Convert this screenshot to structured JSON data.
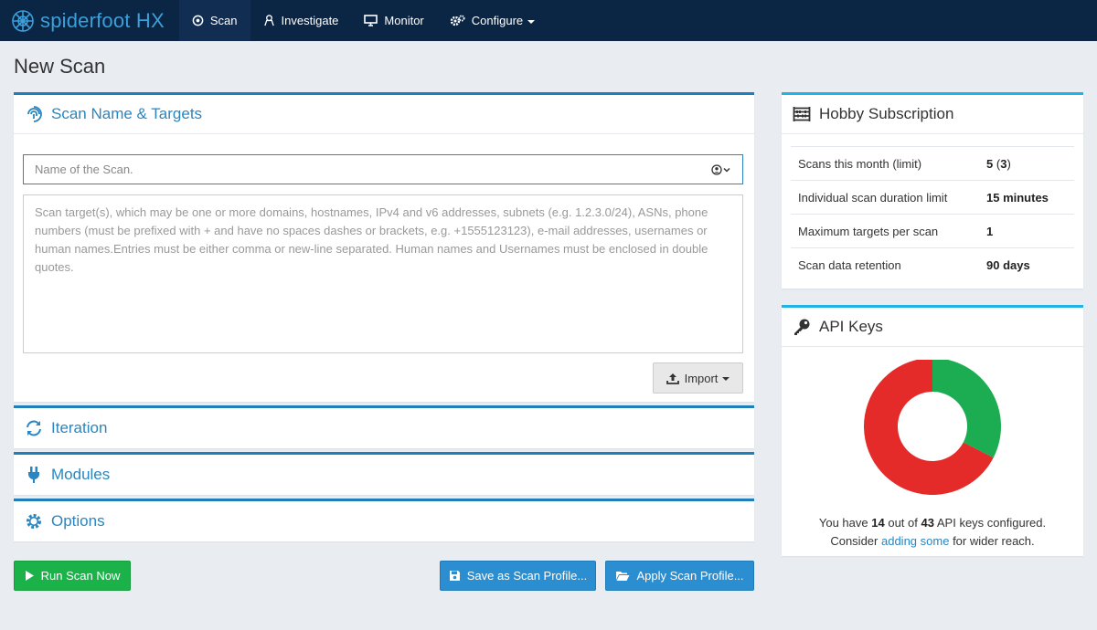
{
  "navbar": {
    "brand": "spiderfoot HX",
    "items": [
      {
        "label": "Scan",
        "icon": "target-icon",
        "active": true
      },
      {
        "label": "Investigate",
        "icon": "investigate-icon",
        "active": false
      },
      {
        "label": "Monitor",
        "icon": "monitor-icon",
        "active": false
      },
      {
        "label": "Configure",
        "icon": "gears-icon",
        "active": false,
        "dropdown": true
      }
    ]
  },
  "page_title": "New Scan",
  "targets_panel": {
    "title": "Scan Name & Targets",
    "name_placeholder": "Name of the Scan.",
    "name_value": "",
    "targets_placeholder": "Scan target(s), which may be one or more domains, hostnames, IPv4 and v6 addresses, subnets (e.g. 1.2.3.0/24), ASNs, phone numbers (must be prefixed with + and have no spaces dashes or brackets, e.g. +1555123123), e-mail addresses, usernames or human names.Entries must be either comma or new-line separated. Human names and Usernames must be enclosed in double quotes.",
    "import_label": "Import"
  },
  "sections": {
    "iteration": "Iteration",
    "modules": "Modules",
    "options": "Options"
  },
  "actions": {
    "run": "Run Scan Now",
    "save_profile": "Save as Scan Profile...",
    "apply_profile": "Apply Scan Profile..."
  },
  "subscription": {
    "title": "Hobby Subscription",
    "rows": [
      {
        "label": "Scans this month (limit)",
        "value": "5",
        "limit": "3"
      },
      {
        "label": "Individual scan duration limit",
        "value": "15 minutes"
      },
      {
        "label": "Maximum targets per scan",
        "value": "1"
      },
      {
        "label": "Scan data retention",
        "value": "90 days"
      }
    ]
  },
  "api_keys": {
    "title": "API Keys",
    "configured": "14",
    "total": "43",
    "text_prefix": "You have",
    "text_mid": "out of",
    "text_suffix": "API keys configured.",
    "text2_prefix": "Consider",
    "link": "adding some",
    "text2_suffix": "for wider reach.",
    "colors": {
      "configured": "#1cac52",
      "missing": "#e52a2a"
    }
  },
  "colors": {
    "accent": "#2a86c0",
    "navbar": "#0b2545",
    "success": "#1cb24a"
  }
}
